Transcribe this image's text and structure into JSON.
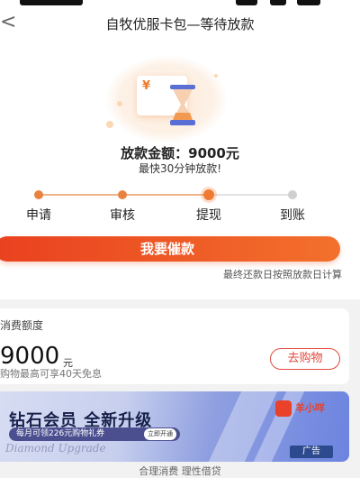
{
  "status_bar": {
    "partial_text": ""
  },
  "nav": {
    "title": "自牧优服卡包—等待放款",
    "back_glyph": "<"
  },
  "loan": {
    "amount_label": "放款金额：9000元",
    "eta": "最快30分钟放款!",
    "currency_symbol": "¥"
  },
  "steps": {
    "items": [
      {
        "label": "申请",
        "state": "done"
      },
      {
        "label": "审核",
        "state": "done"
      },
      {
        "label": "提现",
        "state": "current"
      },
      {
        "label": "到账",
        "state": "pending"
      }
    ],
    "colors": {
      "done": "#e8823e",
      "current": "#ef7b33",
      "pending": "#cfcfcf",
      "line_done": "#f0b48a",
      "line_pending": "#e2e2e2"
    }
  },
  "actions": {
    "urge_label": "我要催款",
    "repay_note": "最终还款日按照放款日计算"
  },
  "credit": {
    "title": "消费额度",
    "amount": "9000",
    "unit": "元",
    "desc": "购物最高可享40天免息",
    "shop_label": "去购物"
  },
  "banner": {
    "headline": "钻石会员  全新升级",
    "pill_text": "每月可领226元购物礼券",
    "pill_button": "立即开通",
    "script": "Diamond Upgrade",
    "brand": "羊小咩",
    "ad_label": "广告"
  },
  "footer": {
    "slogan": "合理消费 理性借贷"
  },
  "colors": {
    "accent": "#ef6a2a",
    "accent_red": "#e3493c"
  }
}
